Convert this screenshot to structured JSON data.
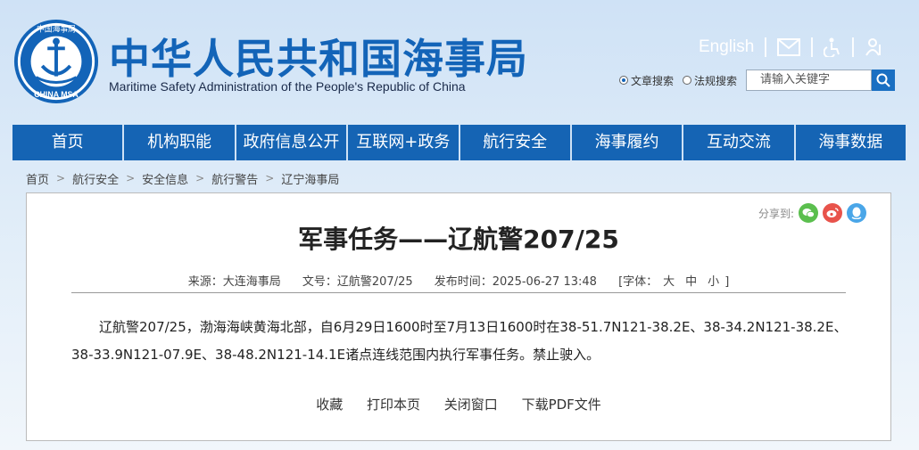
{
  "header": {
    "logo_text_top": "中国海事局",
    "logo_text_bottom": "CHINA MSA",
    "title": "中华人民共和国海事局",
    "subtitle": "Maritime Safety Administration of the People's Republic of China",
    "english_link": "English",
    "search": {
      "option_article": "文章搜索",
      "option_law": "法规搜索",
      "placeholder": "请输入关键字"
    }
  },
  "nav": {
    "items": [
      "首页",
      "机构职能",
      "政府信息公开",
      "互联网+政务",
      "航行安全",
      "海事履约",
      "互动交流",
      "海事数据"
    ]
  },
  "breadcrumb": [
    "首页",
    "航行安全",
    "安全信息",
    "航行警告",
    "辽宁海事局"
  ],
  "article": {
    "share_label": "分享到:",
    "title": "军事任务——辽航警207/25",
    "meta": {
      "source": "来源：大连海事局",
      "doc_no": "文号：辽航警207/25",
      "published": "发布时间：2025-06-27 13:48",
      "font_label": "[字体：",
      "font_large": "大",
      "font_medium": "中",
      "font_small": "小",
      "font_close": "]"
    },
    "body": "辽航警207/25，渤海海峡黄海北部，自6月29日1600时至7月13日1600时在38-51.7N121-38.2E、38-34.2N121-38.2E、38-33.9N121-07.9E、38-48.2N121-14.1E诸点连线范围内执行军事任务。禁止驶入。",
    "actions": [
      "收藏",
      "打印本页",
      "关闭窗口",
      "下载PDF文件"
    ]
  },
  "colors": {
    "brand_blue": "#1564b4",
    "wechat": "#5bbf4e",
    "weibo": "#e8534b",
    "qq": "#4aa6e8"
  }
}
